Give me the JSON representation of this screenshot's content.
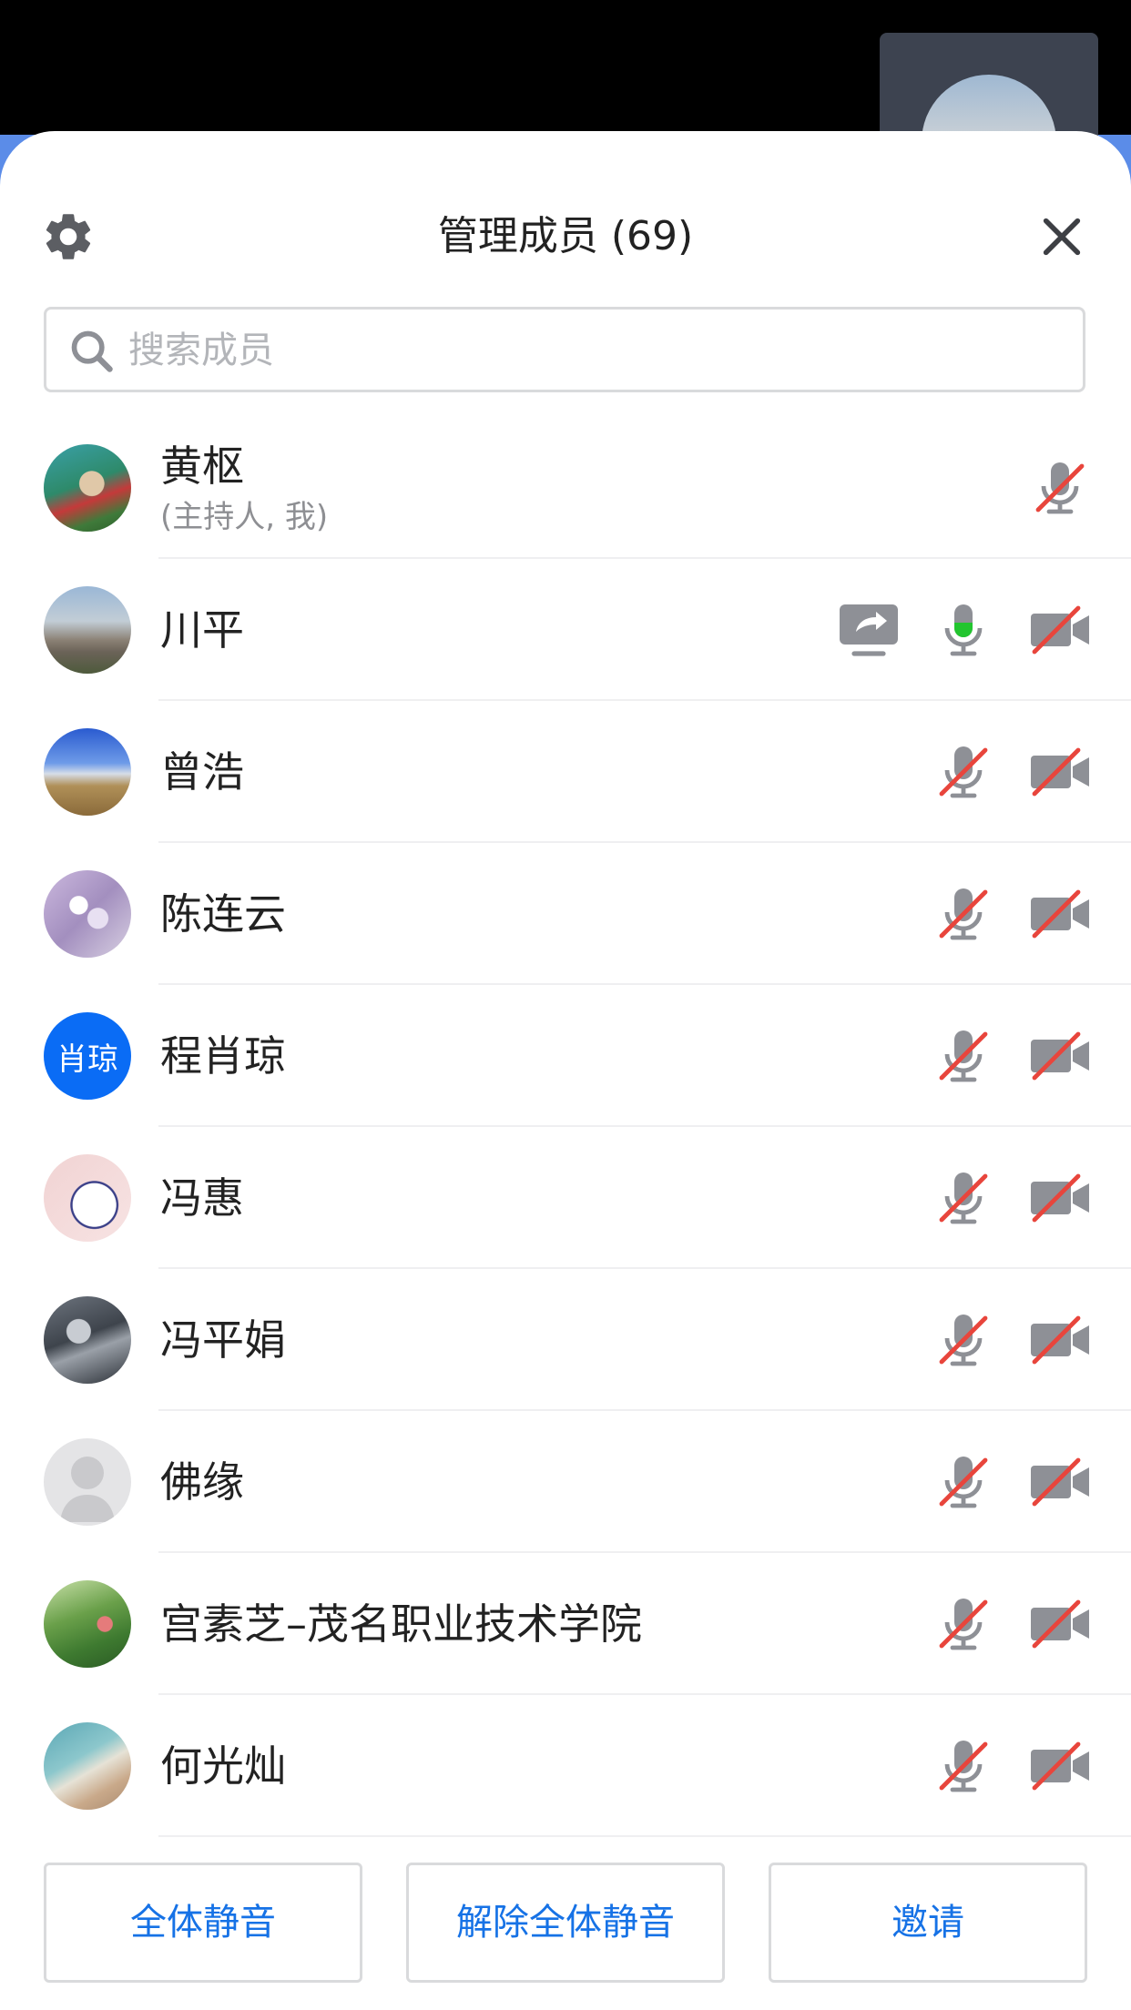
{
  "header": {
    "title": "管理成员 (69)",
    "settings_icon": "gear-icon",
    "close_icon": "close-icon"
  },
  "search": {
    "placeholder": "搜索成员",
    "icon": "search-icon"
  },
  "members": [
    {
      "name": "黄枢",
      "subtitle": "(主持人, 我)",
      "avatar": "photo",
      "mic": "muted",
      "camera": "none",
      "sharing": false
    },
    {
      "name": "川平",
      "avatar": "photo",
      "mic": "active",
      "camera": "off",
      "sharing": true
    },
    {
      "name": "曾浩",
      "avatar": "photo",
      "mic": "muted",
      "camera": "off",
      "sharing": false
    },
    {
      "name": "陈连云",
      "avatar": "photo",
      "mic": "muted",
      "camera": "off",
      "sharing": false
    },
    {
      "name": "程肖琼",
      "avatar_text": "肖琼",
      "avatar_color": "#0a6cf5",
      "mic": "muted",
      "camera": "off",
      "sharing": false
    },
    {
      "name": "冯惠",
      "avatar": "photo",
      "mic": "muted",
      "camera": "off",
      "sharing": false
    },
    {
      "name": "冯平娟",
      "avatar": "photo",
      "mic": "muted",
      "camera": "off",
      "sharing": false
    },
    {
      "name": "佛缘",
      "avatar": "default",
      "mic": "muted",
      "camera": "off",
      "sharing": false
    },
    {
      "name": "宫素芝–茂名职业技术学院",
      "avatar": "photo",
      "mic": "muted",
      "camera": "off",
      "sharing": false
    },
    {
      "name": "何光灿",
      "avatar": "photo",
      "mic": "muted",
      "camera": "off",
      "sharing": false
    }
  ],
  "footer": {
    "mute_all": "全体静音",
    "unmute_all": "解除全体静音",
    "invite": "邀请"
  },
  "colors": {
    "accent": "#1672e6",
    "mute_slash": "#e8453c",
    "mic_active": "#22c52f",
    "icon_gray": "#8e9096"
  }
}
